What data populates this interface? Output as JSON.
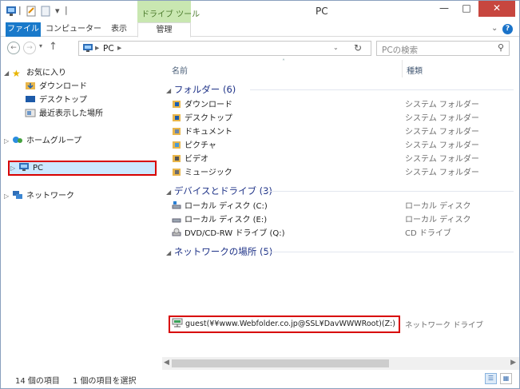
{
  "window": {
    "title": "PC"
  },
  "quick_access": {
    "separator": "|",
    "dropdown": "▾"
  },
  "ribbon": {
    "contextual_header": "ドライブ ツール",
    "tabs": [
      "ファイル",
      "コンピューター",
      "表示",
      "管理"
    ]
  },
  "address": {
    "path_arrow": "▸",
    "location": "PC",
    "trail_arrow": "▸",
    "search_placeholder": "PCの検索"
  },
  "nav_pane": {
    "favorites": "お気に入り",
    "favorites_items": [
      "ダウンロード",
      "デスクトップ",
      "最近表示した場所"
    ],
    "homegroup": "ホームグループ",
    "pc": "PC",
    "network": "ネットワーク"
  },
  "columns": {
    "name": "名前",
    "type": "種類"
  },
  "groups": {
    "folders": "フォルダー (6)",
    "devices": "デバイスとドライブ (3)",
    "network": "ネットワークの場所 (5)"
  },
  "folders": [
    {
      "name": "ダウンロード",
      "type": "システム フォルダー"
    },
    {
      "name": "デスクトップ",
      "type": "システム フォルダー"
    },
    {
      "name": "ドキュメント",
      "type": "システム フォルダー"
    },
    {
      "name": "ピクチャ",
      "type": "システム フォルダー"
    },
    {
      "name": "ビデオ",
      "type": "システム フォルダー"
    },
    {
      "name": "ミュージック",
      "type": "システム フォルダー"
    }
  ],
  "drives": [
    {
      "name": "ローカル ディスク (C:)",
      "type": "ローカル ディスク"
    },
    {
      "name": "ローカル ディスク (E:)",
      "type": "ローカル ディスク"
    },
    {
      "name": "DVD/CD-RW ドライブ (Q:)",
      "type": "CD ドライブ"
    }
  ],
  "network_location": {
    "name": "guest(¥¥www.Webfolder.co.jp@SSL¥DavWWWRoot)(Z:)",
    "type": "ネットワーク ドライブ"
  },
  "status": {
    "item_count": "14 個の項目",
    "selected": "1 個の項目を選択"
  },
  "colors": {
    "file_tab": "#1979ca",
    "drive_tools": "#c9e7b1",
    "highlight": "#d80000",
    "group_text": "#1e3287"
  }
}
